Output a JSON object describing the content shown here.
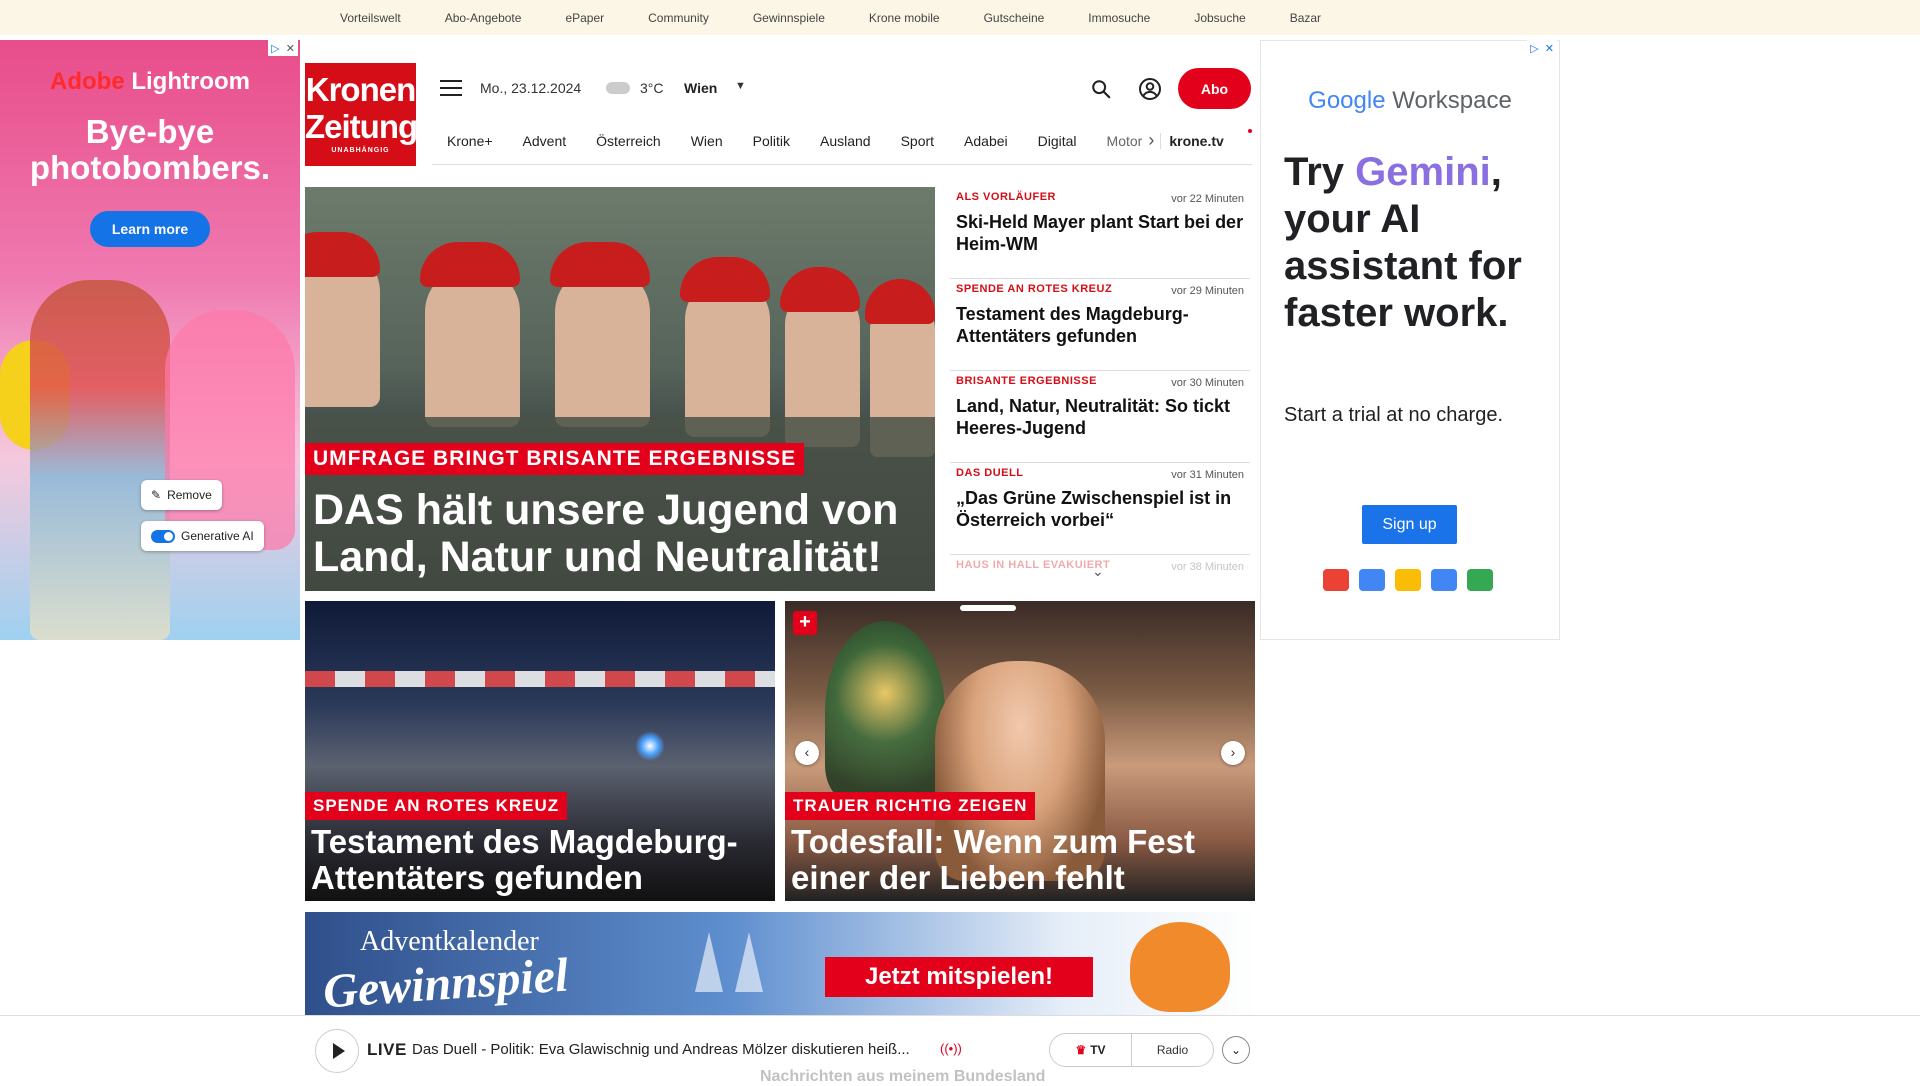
{
  "topnav": [
    "Vorteilswelt",
    "Abo-Angebote",
    "ePaper",
    "Community",
    "Gewinnspiele",
    "Krone mobile",
    "Gutscheine",
    "Immosuche",
    "Jobsuche",
    "Bazar"
  ],
  "ad_left": {
    "brand_adobe": "Adobe",
    "brand_product": "Lightroom",
    "headline": "Bye-bye photobombers.",
    "cta": "Learn more",
    "remove_label": "Remove",
    "genai_label": "Generative AI"
  },
  "header": {
    "logo_line1": "Kronen",
    "logo_line2": "Zeitung",
    "logo_tagline": "UNABHÄNGIG",
    "date": "Mo., 23.12.2024",
    "temperature": "3°C",
    "city": "Wien",
    "abo_label": "Abo"
  },
  "nav": {
    "items": [
      "Krone+",
      "Advent",
      "Österreich",
      "Wien",
      "Politik",
      "Ausland",
      "Sport",
      "Adabei",
      "Digital",
      "Motor"
    ],
    "tv_label": "krone.tv"
  },
  "hero": {
    "kicker": "UMFRAGE BRINGT BRISANTE ERGEBNISSE",
    "title": "DAS hält unsere Jugend von Land, Natur und Neutralität!"
  },
  "side_list": [
    {
      "kicker": "ALS VORLÄUFER",
      "time": "vor 22 Minuten",
      "headline": "Ski-Held Mayer plant Start bei der Heim-WM"
    },
    {
      "kicker": "SPENDE AN ROTES KREUZ",
      "time": "vor 29 Minuten",
      "headline": "Testament des Magdeburg-Attentäters gefunden"
    },
    {
      "kicker": "BRISANTE ERGEBNISSE",
      "time": "vor 30 Minuten",
      "headline": "Land, Natur, Neutralität: So tickt Heeres-Jugend"
    },
    {
      "kicker": "DAS DUELL",
      "time": "vor 31 Minuten",
      "headline": "„Das Grüne Zwischenspiel ist in Österreich vorbei“"
    },
    {
      "kicker": "HAUS IN HALL EVAKUIERT",
      "time": "vor 38 Minuten",
      "headline": ""
    }
  ],
  "cards": [
    {
      "kicker": "SPENDE AN ROTES KREUZ",
      "title": "Testament des Magdeburg-Attentäters gefunden"
    },
    {
      "kicker": "TRAUER RICHTIG ZEIGEN",
      "title": "Todesfall: Wenn zum Fest einer der Lieben fehlt"
    }
  ],
  "advent": {
    "line1": "Adventkalender",
    "line2": "Gewinnspiel",
    "cta": "Jetzt mitspielen!"
  },
  "ad_right": {
    "brand_google": "Google",
    "brand_product": "Workspace",
    "head_1": "Try ",
    "head_gemini": "Gemini",
    "head_2": ", your AI assistant for faster work.",
    "sub": "Start a trial at no charge.",
    "cta": "Sign up"
  },
  "livebar": {
    "live": "LIVE",
    "text": "Das Duell - Politik: Eva Glawischnig und Andreas Mölzer diskutieren heiß...",
    "tv": "TV",
    "radio": "Radio",
    "behind_text": "Nachrichten aus meinem Bundesland"
  },
  "colors": {
    "brand_red": "#e2001a",
    "topbar_bg": "#fcf6e7"
  }
}
